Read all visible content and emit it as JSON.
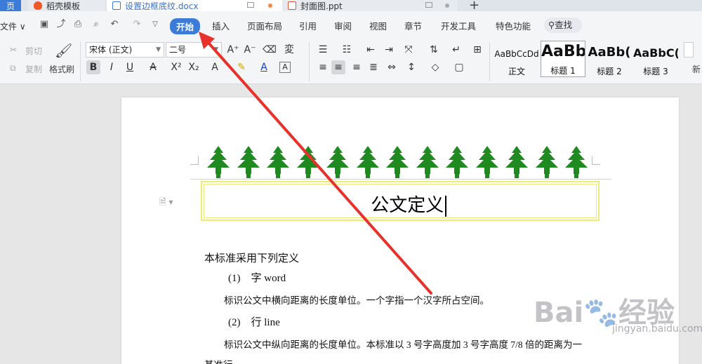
{
  "tabs": [
    {
      "label": "页",
      "kind": "home"
    },
    {
      "label": "稻壳模板",
      "kind": "wps"
    },
    {
      "label": "设置边框底纹.docx",
      "kind": "word",
      "active": true
    },
    {
      "label": "封面图.ppt",
      "kind": "ppt"
    }
  ],
  "menu": {
    "file": "文件 ∨",
    "items": [
      "开始",
      "插入",
      "页面布局",
      "引用",
      "审阅",
      "视图",
      "章节",
      "开发工具",
      "特色功能"
    ],
    "search": "查找"
  },
  "ribbon": {
    "cut": "剪切",
    "copy": "复制",
    "format_painter": "格式刷",
    "font_name": "宋体 (正文)",
    "font_size": "二号",
    "styles": [
      {
        "preview": "AaBbCcDd",
        "label": "正文"
      },
      {
        "preview": "AaBb",
        "label": "标题 1"
      },
      {
        "preview": "AaBb(",
        "label": "标题 2"
      },
      {
        "preview": "AaBbC(",
        "label": "标题 3"
      }
    ],
    "new_style": "新"
  },
  "document": {
    "title": "公文定义",
    "lines": [
      "本标准采用下列定义",
      "(1)　字 word",
      "标识公文中横向距离的长度单位。一个字指一个汉字所占空间。",
      "(2)　行 line",
      "标识公文中纵向距离的长度单位。本标准以 3 号字高度加 3 号字高度 7/8 倍的距离为一",
      "基准行"
    ]
  },
  "watermark": {
    "brand": "Bai",
    "brand_cn": "经验",
    "domain": "jingyan.baidu.com"
  },
  "colors": {
    "accent": "#3d7bd9",
    "tree": "#1f8a1f",
    "arrow": "#e8312a",
    "border": "#ecec75"
  }
}
